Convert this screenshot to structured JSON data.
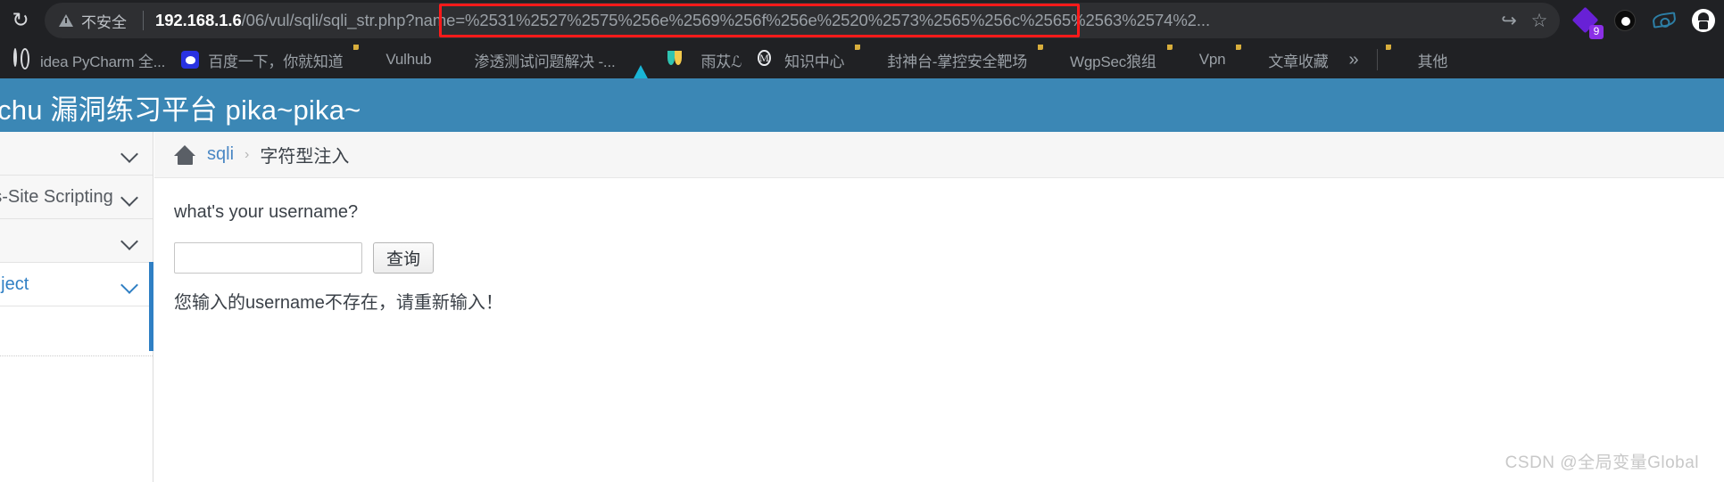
{
  "browser": {
    "reload_icon": "reload-icon",
    "security_label": "不安全",
    "url": {
      "host": "192.168.1.6",
      "path": "/06/vul/sqli/sqli_str.php?name",
      "query": "=%2531%2527%2575%256e%2569%256f%256e%2520%2573%2565%256c%2565%2563%2574%2..."
    },
    "share_icon": "share-icon",
    "bookmark_star_icon": "star-icon",
    "extensions": [
      {
        "name": "purple-diamond-extension-icon",
        "badge": "9"
      },
      {
        "name": "black-ring-extension-icon",
        "badge": ""
      },
      {
        "name": "blue-eye-extension-icon",
        "badge": ""
      },
      {
        "name": "profile-avatar-icon",
        "badge": ""
      }
    ],
    "bookmarks": [
      {
        "label": "idea PyCharm 全...",
        "icon": "globe-icon"
      },
      {
        "label": "百度一下，你就知道",
        "icon": "baidu-icon"
      },
      {
        "label": "Vulhub",
        "icon": "folder-icon"
      },
      {
        "label": "渗透测试问题解决 -...",
        "icon": "bird-icon"
      },
      {
        "label": "",
        "icon": "blue-triangle-icon"
      },
      {
        "label": "雨苁ℒ",
        "icon": "leaf-icon"
      },
      {
        "label": "知识中心",
        "icon": "circled-m-icon"
      },
      {
        "label": "封神台-掌控安全靶场",
        "icon": "folder-icon"
      },
      {
        "label": "WgpSec狼组",
        "icon": "folder-icon"
      },
      {
        "label": "Vpn",
        "icon": "folder-icon"
      },
      {
        "label": "文章收藏",
        "icon": "folder-icon"
      }
    ],
    "bookmarks_overflow_icon": "chevron-double-right-icon",
    "bookmarks_other": {
      "label": "其他",
      "icon": "folder-icon"
    }
  },
  "page": {
    "banner_title": "Pikachu 漏洞练习平台 pika~pika~",
    "sidebar": [
      {
        "label": "",
        "active": false
      },
      {
        "label": "Cross-Site Scripting",
        "active": false
      },
      {
        "label": "",
        "active": false
      },
      {
        "label": "Sql Inject",
        "active": true
      }
    ],
    "breadcrumb": {
      "home_icon": "home-icon",
      "link": "sqli",
      "separator": "›",
      "current": "字符型注入"
    },
    "form": {
      "prompt": "what's your username?",
      "input_value": "",
      "input_placeholder": "",
      "submit_label": "查询"
    },
    "result_message": "您输入的username不存在，请重新输入！",
    "watermark": "CSDN @全局变量Global"
  }
}
